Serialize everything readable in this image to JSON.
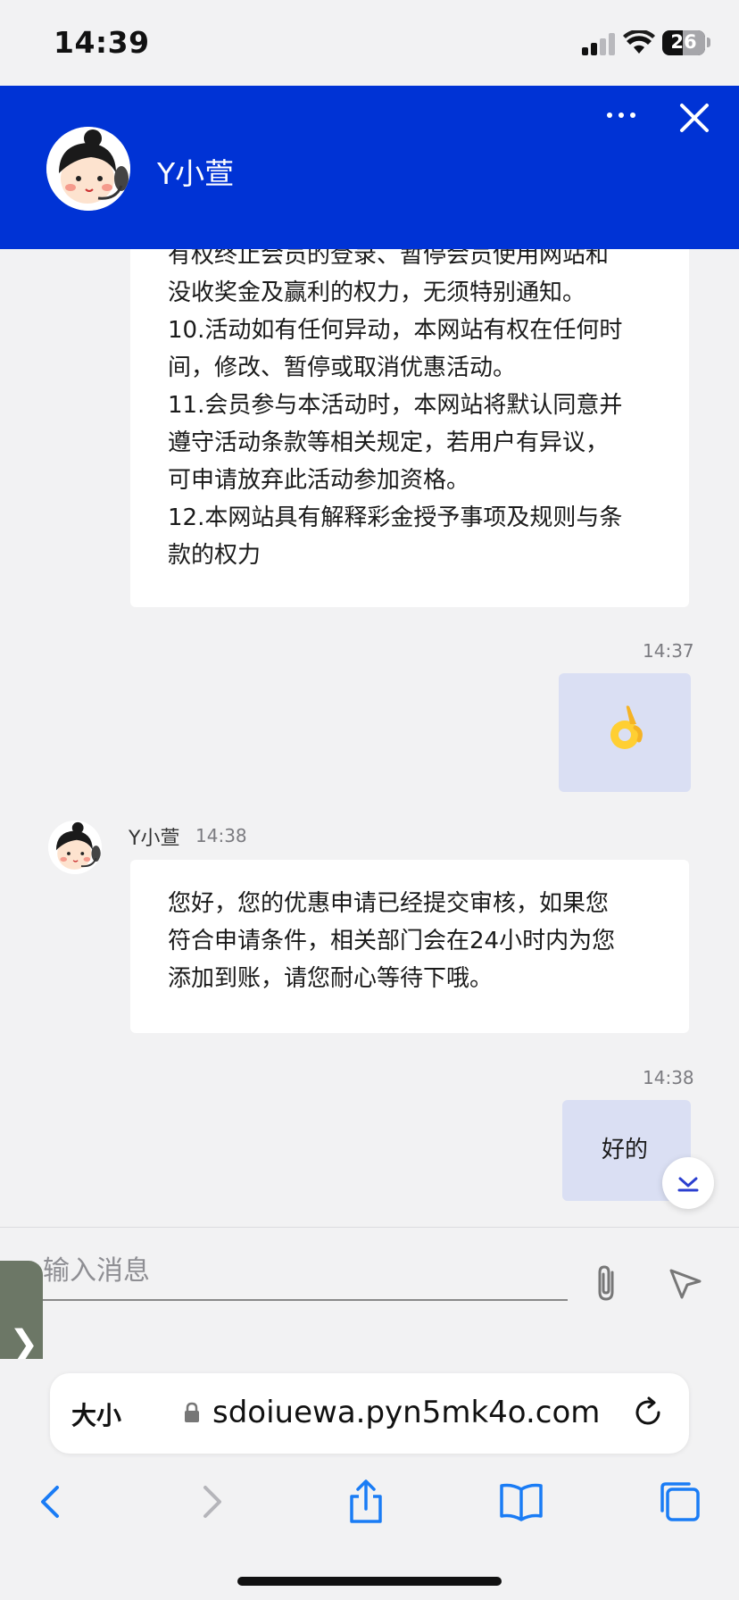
{
  "status_bar": {
    "time": "14:39",
    "battery": "26"
  },
  "header": {
    "title": "Y小萱"
  },
  "messages": {
    "first_agent_lines": [
      "有权终止会员的登录、暂停会员使用网站和",
      "没收奖金及赢利的权力，无须特别通知。",
      "10.活动如有任何异动，本网站有权在任何时",
      "间，修改、暂停或取消优惠活动。",
      "11.会员参与本活动时，本网站将默认同意并",
      "遵守活动条款等相关规定，若用户有异议，",
      "可申请放弃此活动参加资格。",
      "12.本网站具有解释彩金授予事项及规则与条",
      "款的权力"
    ],
    "user_1": {
      "time": "14:37",
      "emoji": "👌"
    },
    "agent_2": {
      "name": "Y小萱",
      "time": "14:38",
      "lines": [
        "您好，您的优惠申请已经提交审核，如果您",
        "符合申请条件，相关部门会在24小时内为您",
        "添加到账，请您耐心等待下哦。"
      ]
    },
    "user_2": {
      "time": "14:38",
      "text": "好的"
    }
  },
  "input": {
    "placeholder": "输入消息",
    "value": ""
  },
  "side_tab": {
    "glyph": "❯"
  },
  "browser": {
    "text_size_label": "大小",
    "url": "sdoiuewa.pyn5mk4o.com"
  },
  "colors": {
    "header_blue": "#0033d5",
    "user_bubble": "#dadff3",
    "ios_blue": "#1a7cf5"
  }
}
